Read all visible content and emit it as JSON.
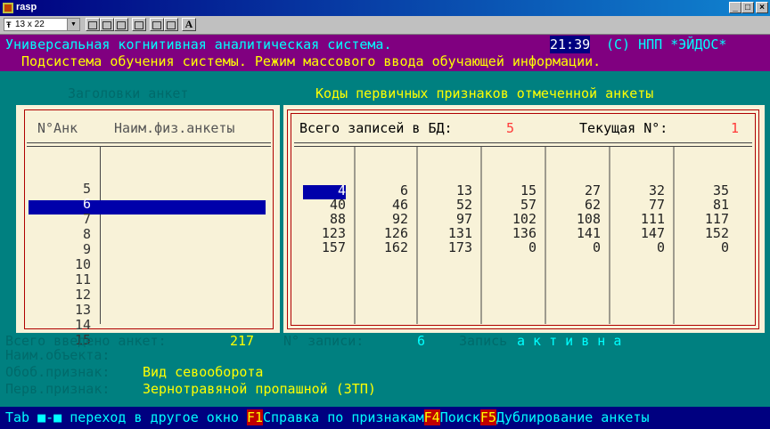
{
  "window": {
    "title": "rasp",
    "min_label": "_",
    "max_label": "□",
    "close_label": "×"
  },
  "toolbar": {
    "font_size": "13 x 22",
    "font_prefix": "Ŧ",
    "font_button": "A"
  },
  "header": {
    "line1_text": "Универсальная когнитивная аналитическая система.",
    "time": "21:39",
    "copyright": "(C) НПП *ЭЙДОС*",
    "line2": "Подсистема обучения системы. Режим массового ввода обучающей информации."
  },
  "left_panel": {
    "title": "Заголовки анкет",
    "col1": "N°Анк",
    "col2": "Наим.физ.анкеты",
    "rows": [
      "5",
      "6",
      "7",
      "8",
      "9",
      "10",
      "11",
      "12",
      "13",
      "14",
      "15"
    ],
    "selected_index": 1
  },
  "right_panel": {
    "title": "Коды первичных признаков отмеченной анкеты",
    "total_label": "Всего записей в БД:",
    "total_value": "5",
    "current_label": "Текущая N°:",
    "current_value": "1",
    "grid": [
      [
        "4",
        "40",
        "88",
        "123",
        "157"
      ],
      [
        "6",
        "46",
        "92",
        "126",
        "162"
      ],
      [
        "13",
        "52",
        "97",
        "131",
        "173"
      ],
      [
        "15",
        "57",
        "102",
        "136",
        "0"
      ],
      [
        "27",
        "62",
        "108",
        "141",
        "0"
      ],
      [
        "32",
        "77",
        "111",
        "147",
        "0"
      ],
      [
        "35",
        "81",
        "117",
        "152",
        "0"
      ]
    ]
  },
  "info": {
    "total_label": "Всего введено анкет:",
    "total_value": "217",
    "record_label": "N° записи:",
    "record_value": "6",
    "record_state_label": "Запись",
    "record_state": "а к т и в н а",
    "object_label": "Наим.объекта:",
    "gen_label": "Обоб.признак:",
    "gen_value": "Вид севооборота",
    "prim_label": "Перв.признак:",
    "prim_value": "Зернотравяной пропашной (ЗТП)"
  },
  "statusbar": {
    "tab_text": "Tab ■-■ переход в другое окно ",
    "f1_key": "F1",
    "f1_label": "Справка по признакам",
    "f4_key": "F4",
    "f4_label": "Поиск",
    "f5_key": "F5",
    "f5_label": "Дублирование анкеты"
  }
}
